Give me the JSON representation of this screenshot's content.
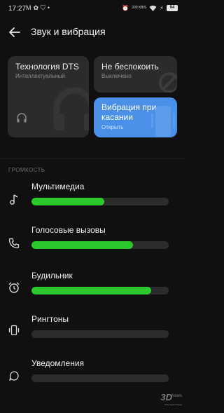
{
  "status_bar": {
    "time": "17:27",
    "left_icons": [
      "gmail-icon",
      "photos-icon",
      "shield-icon",
      "dot-icon"
    ],
    "right_icons": [
      "alarm-icon",
      "data-speed-icon",
      "wifi-icon",
      "battery-charging-icon"
    ],
    "data_speed": "200 KB/S",
    "battery_level": "94"
  },
  "header": {
    "title": "Звук и вибрация"
  },
  "tiles": {
    "dts": {
      "title": "Технология DTS",
      "subtitle": "Интеллектуальный"
    },
    "dnd": {
      "title": "Не беспокоить",
      "subtitle": "Выключено"
    },
    "vibration": {
      "title": "Вибрация при касании",
      "subtitle": "Открыть",
      "accent": "#4a90e8"
    }
  },
  "volume": {
    "section_label": "ГРОМКОСТЬ",
    "fill_color": "#2cc92c",
    "items": [
      {
        "label": "Мультимедиа",
        "icon": "music-note-icon",
        "level": 0.53
      },
      {
        "label": "Голосовые вызовы",
        "icon": "phone-icon",
        "level": 0.74
      },
      {
        "label": "Будильник",
        "icon": "alarm-clock-icon",
        "level": 0.87
      },
      {
        "label": "Рингтоны",
        "icon": "vibrate-phone-icon",
        "level": 0
      },
      {
        "label": "Уведомления",
        "icon": "notification-bubble-icon",
        "level": 0
      }
    ]
  },
  "watermark": {
    "brand": "3D",
    "suffix": "News",
    "tagline": "Daily Digital Digest"
  }
}
